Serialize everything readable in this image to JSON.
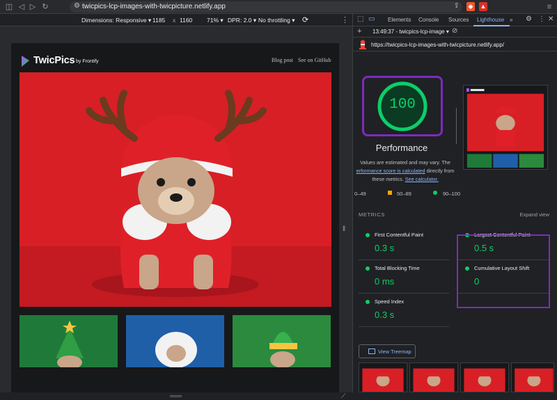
{
  "browser": {
    "url": "twicpics-lcp-images-with-twicpicture.netlify.app"
  },
  "device_toolbar": {
    "dimensions": "Dimensions: Responsive",
    "width": "1185",
    "times": "x",
    "height": "1160",
    "zoom": "71%",
    "dpr": "DPR: 2.0",
    "throttling": "No throttling"
  },
  "page": {
    "brand": "TwicPics",
    "by": "by Frontify",
    "link_blog": "Blog post",
    "link_github": "See on GitHub"
  },
  "devtools": {
    "tabs": [
      "Elements",
      "Console",
      "Sources",
      "Lighthouse"
    ],
    "more": "»",
    "report_label": "13:49:37 - twicpics-lcp-image",
    "report_url": "https://twicpics-lcp-images-with-twicpicture.netlify.app/",
    "score": "100",
    "category": "Performance",
    "note_prefix": "Values are estimated and may vary. The",
    "note_link": "erformance score is calculated",
    "note_mid": "directly from",
    "note_suffix": "these metrics.",
    "note_link2": "See calculator.",
    "legend": {
      "fail": "0–49",
      "average": "50–89",
      "pass": "90–100"
    },
    "metrics_title": "METRICS",
    "expand": "Expand view",
    "metrics": [
      {
        "label": "First Contentful Paint",
        "value": "0.3 s"
      },
      {
        "label": "Largest Contentful Paint",
        "value": "0.5 s"
      },
      {
        "label": "Total Blocking Time",
        "value": "0 ms"
      },
      {
        "label": "Cumulative Layout Shift",
        "value": "0"
      },
      {
        "label": "Speed Index",
        "value": "0.3 s"
      }
    ],
    "treemap": "View Treemap",
    "colors": {
      "pass": "#0cce6b",
      "average": "#ffa400",
      "highlight": "#7b2cbf",
      "active_tab": "#8ab4f8"
    }
  }
}
